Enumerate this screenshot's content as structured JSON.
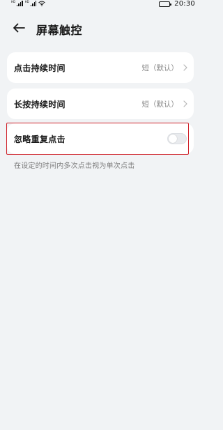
{
  "status_bar": {
    "sim1_label": "HD",
    "sim2_label": "HD",
    "time": "20:30",
    "battery_level": 1.0
  },
  "header": {
    "back_icon": "arrow-left-icon",
    "title": "屏幕触控"
  },
  "settings": {
    "tap_duration": {
      "label": "点击持续时间",
      "value": "短（默认）"
    },
    "long_press_duration": {
      "label": "长按持续时间",
      "value": "短（默认）"
    },
    "ignore_repeat_taps": {
      "label": "忽略重复点击",
      "enabled": false,
      "description": "在设定的时间内多次点击视为单次点击"
    }
  },
  "colors": {
    "background": "#f1f3f5",
    "card": "#ffffff",
    "highlight_border": "#d0232b",
    "secondary_text": "#8a8a8a"
  }
}
